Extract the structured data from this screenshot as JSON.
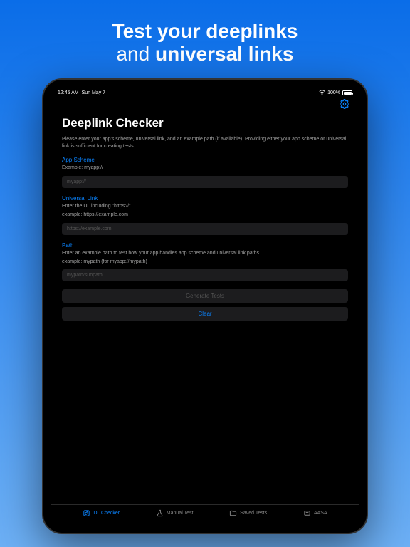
{
  "headline": {
    "line1": "Test your deeplinks",
    "line2_prefix": "and ",
    "line2_bold": "universal links"
  },
  "status_bar": {
    "time": "12:45 AM",
    "date": "Sun May 7",
    "battery_pct": "100%"
  },
  "page": {
    "title": "Deeplink Checker",
    "description": "Please enter your app's scheme, universal link, and an example path (if available). Providing either your app scheme or universal link is sufficient for creating tests."
  },
  "fields": {
    "scheme": {
      "label": "App Scheme",
      "hint": "Example: myapp://",
      "placeholder": "myapp://"
    },
    "universal": {
      "label": "Universal Link",
      "hint1": "Enter the UL including \"https://\".",
      "hint2": "example: https://example.com",
      "placeholder": "https://example.com"
    },
    "path": {
      "label": "Path",
      "hint1": "Enter an example path to test how your app handles app scheme and universal link paths.",
      "hint2": "example: mypath (for myapp://mypath)",
      "placeholder": "mypath/subpath"
    }
  },
  "buttons": {
    "generate": "Generate Tests",
    "clear": "Clear"
  },
  "tabs": {
    "checker": "DL Checker",
    "manual": "Manual Test",
    "saved": "Saved Tests",
    "aasa": "AASA"
  }
}
